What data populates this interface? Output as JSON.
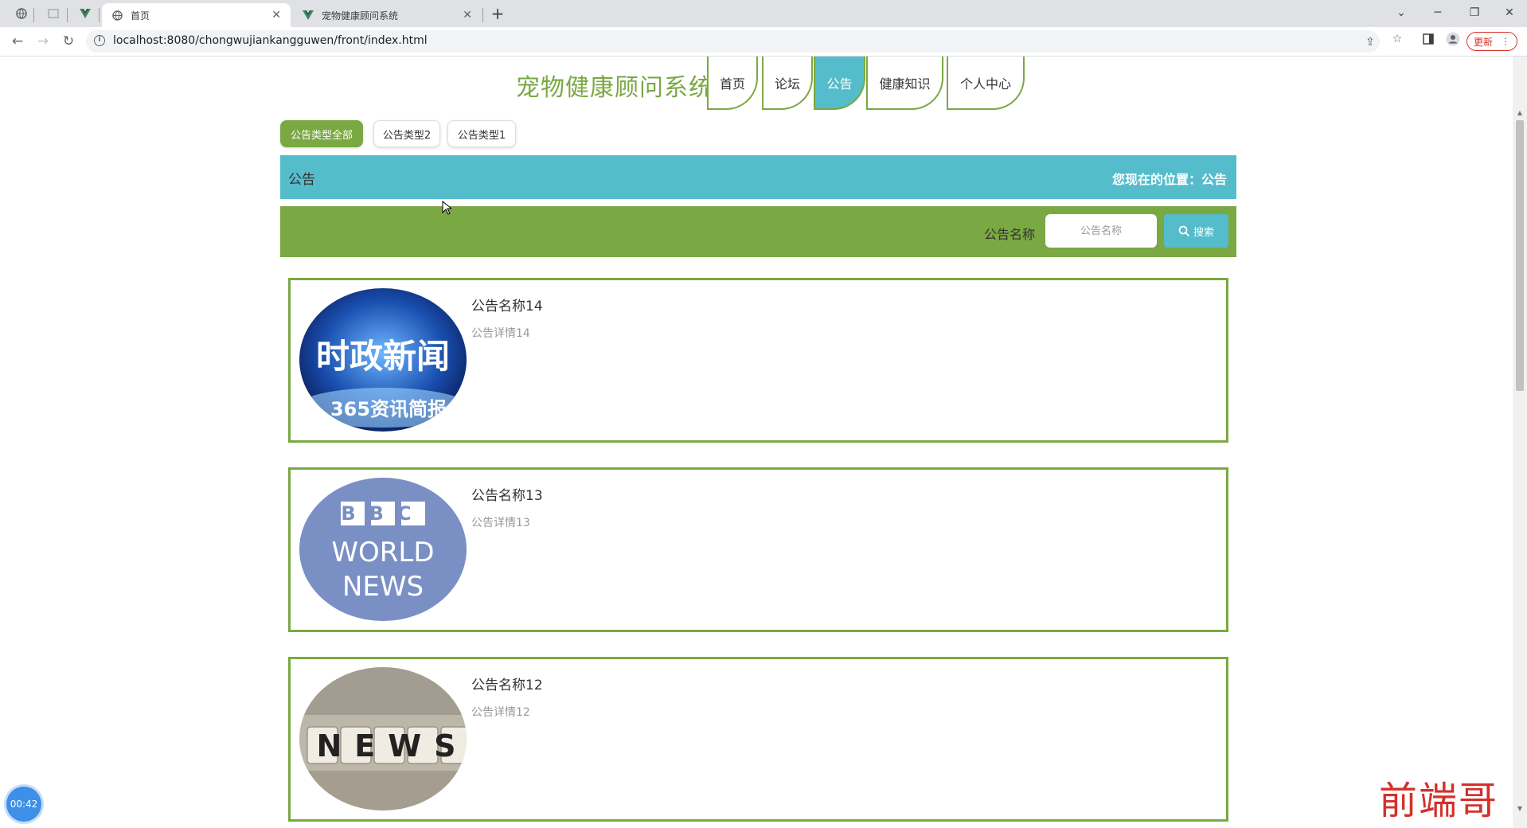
{
  "browser": {
    "tabs": [
      {
        "title": "首页",
        "active": true
      },
      {
        "title": "宠物健康顾问系统",
        "active": false
      }
    ],
    "url": "localhost:8080/chongwujiankangguwen/front/index.html",
    "update_label": "更新"
  },
  "site": {
    "title": "宠物健康顾问系统",
    "nav": [
      "首页",
      "论坛",
      "公告",
      "健康知识",
      "个人中心"
    ],
    "active_nav": "公告"
  },
  "filters": {
    "types": [
      "公告类型全部",
      "公告类型2",
      "公告类型1"
    ],
    "active": "公告类型全部"
  },
  "banner": {
    "title": "公告",
    "location": "您现在的位置：公告"
  },
  "search": {
    "label": "公告名称",
    "placeholder": "公告名称",
    "button_label": "搜索"
  },
  "notices": [
    {
      "name": "公告名称14",
      "detail": "公告详情14",
      "image_text": [
        "时政新闻",
        "365资讯简报"
      ]
    },
    {
      "name": "公告名称13",
      "detail": "公告详情13",
      "image_text": [
        "BBC",
        "WORLD",
        "NEWS"
      ]
    },
    {
      "name": "公告名称12",
      "detail": "公告详情12",
      "image_text": [
        "NEWS"
      ]
    }
  ],
  "overlay": {
    "timer": "00:42",
    "watermark": "前端哥"
  },
  "colors": {
    "green": "#7aa843",
    "teal": "#55bccb"
  }
}
